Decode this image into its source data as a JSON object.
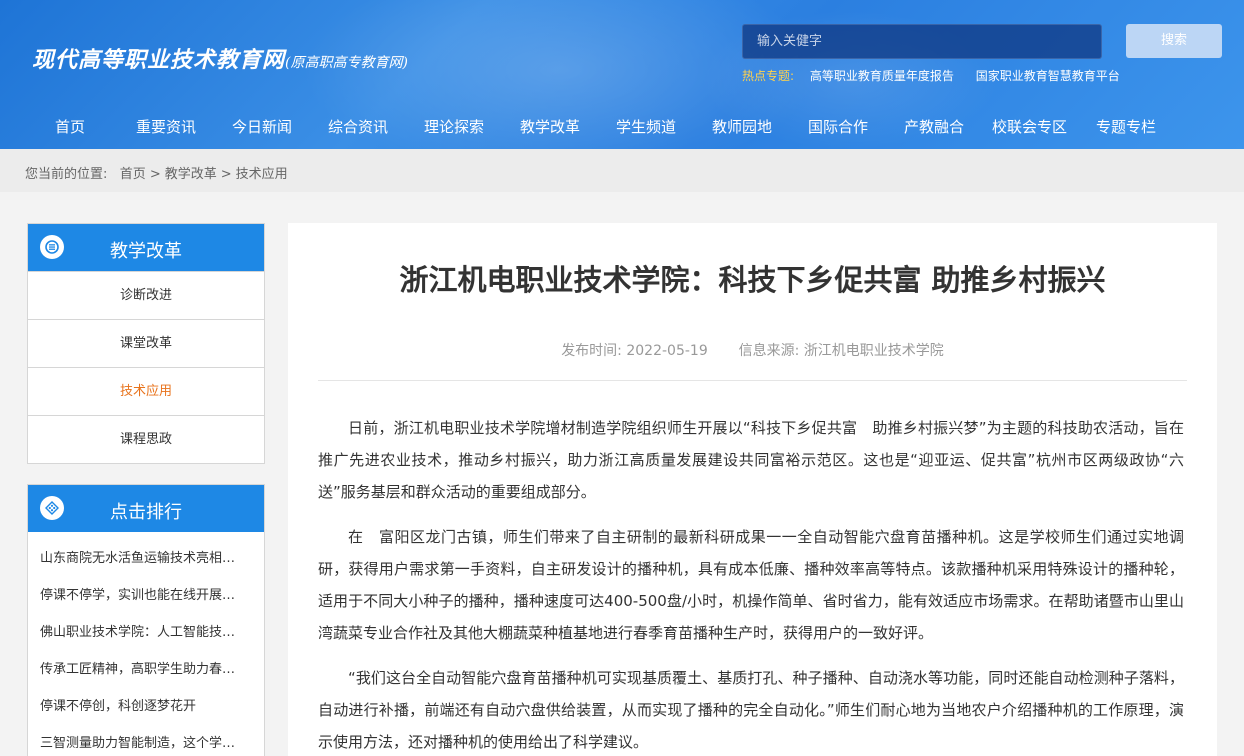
{
  "site": {
    "logo_main": "现代高等职业技术教育网",
    "logo_sub": "(原高职高专教育网)"
  },
  "search": {
    "placeholder": "输入关健字",
    "button_label": "搜索"
  },
  "hot": {
    "label": "热点专题:",
    "links": [
      "高等职业教育质量年度报告",
      "国家职业教育智慧教育平台"
    ]
  },
  "nav": {
    "items": [
      "首页",
      "重要资讯",
      "今日新闻",
      "综合资讯",
      "理论探索",
      "教学改革",
      "学生频道",
      "教师园地",
      "国际合作",
      "产教融合",
      "校联会专区",
      "专题专栏"
    ]
  },
  "breadcrumb": {
    "prefix": "您当前的位置:",
    "items": [
      "首页",
      "教学改革",
      "技术应用"
    ],
    "sep": ">"
  },
  "sidebar": {
    "category": {
      "title": "教学改革",
      "items": [
        "诊断改进",
        "课堂改革",
        "技术应用",
        "课程思政"
      ],
      "active_index": 2
    },
    "ranking": {
      "title": "点击排行",
      "items": [
        "山东商院无水活鱼运输技术亮相…",
        "停课不停学，实训也能在线开展…",
        "佛山职业技术学院：人工智能技…",
        "传承工匠精神，高职学生助力春…",
        "停课不停创，科创逐梦花开",
        "三智测量助力智能制造，这个学…"
      ]
    }
  },
  "article": {
    "title": "浙江机电职业技术学院：科技下乡促共富 助推乡村振兴",
    "publish_label": "发布时间:",
    "publish_date": "2022-05-19",
    "source_label": "信息来源:",
    "source": "浙江机电职业技术学院",
    "paragraphs": [
      "日前，浙江机电职业技术学院增材制造学院组织师生开展以“科技下乡促共富　助推乡村振兴梦”为主题的科技助农活动，旨在推广先进农业技术，推动乡村振兴，助力浙江高质量发展建设共同富裕示范区。这也是“迎亚运、促共富”杭州市区两级政协“六送”服务基层和群众活动的重要组成部分。",
      "在　富阳区龙门古镇，师生们带来了自主研制的最新科研成果一一全自动智能穴盘育苗播种机。这是学校师生们通过实地调研，获得用户需求第一手资料，自主研发设计的播种机，具有成本低廉、播种效率高等特点。该款播种机采用特殊设计的播种轮，适用于不同大小种子的播种，播种速度可达400-500盘/小时，机操作简单、省时省力，能有效适应市场需求。在帮助诸暨市山里山湾蔬菜专业合作社及其他大棚蔬菜种植基地进行春季育苗播种生产时，获得用户的一致好评。",
      "“我们这台全自动智能穴盘育苗播种机可实现基质覆土、基质打孔、种子播种、自动浇水等功能，同时还能自动检测种子落料，自动进行补播，前端还有自动穴盘供给装置，从而实现了播种的完全自动化。”师生们耐心地为当地农户介绍播种机的工作原理，演示使用方法，还对播种机的使用给出了科学建议。"
    ]
  },
  "colors": {
    "header_blue": "#2b7fe0",
    "accent_blue": "#1e88e5",
    "active_orange": "#e8731c",
    "hot_yellow": "#ffd24d"
  },
  "icons": {
    "category_head": "menu-circle-icon",
    "ranking_head": "grid-circle-icon"
  }
}
